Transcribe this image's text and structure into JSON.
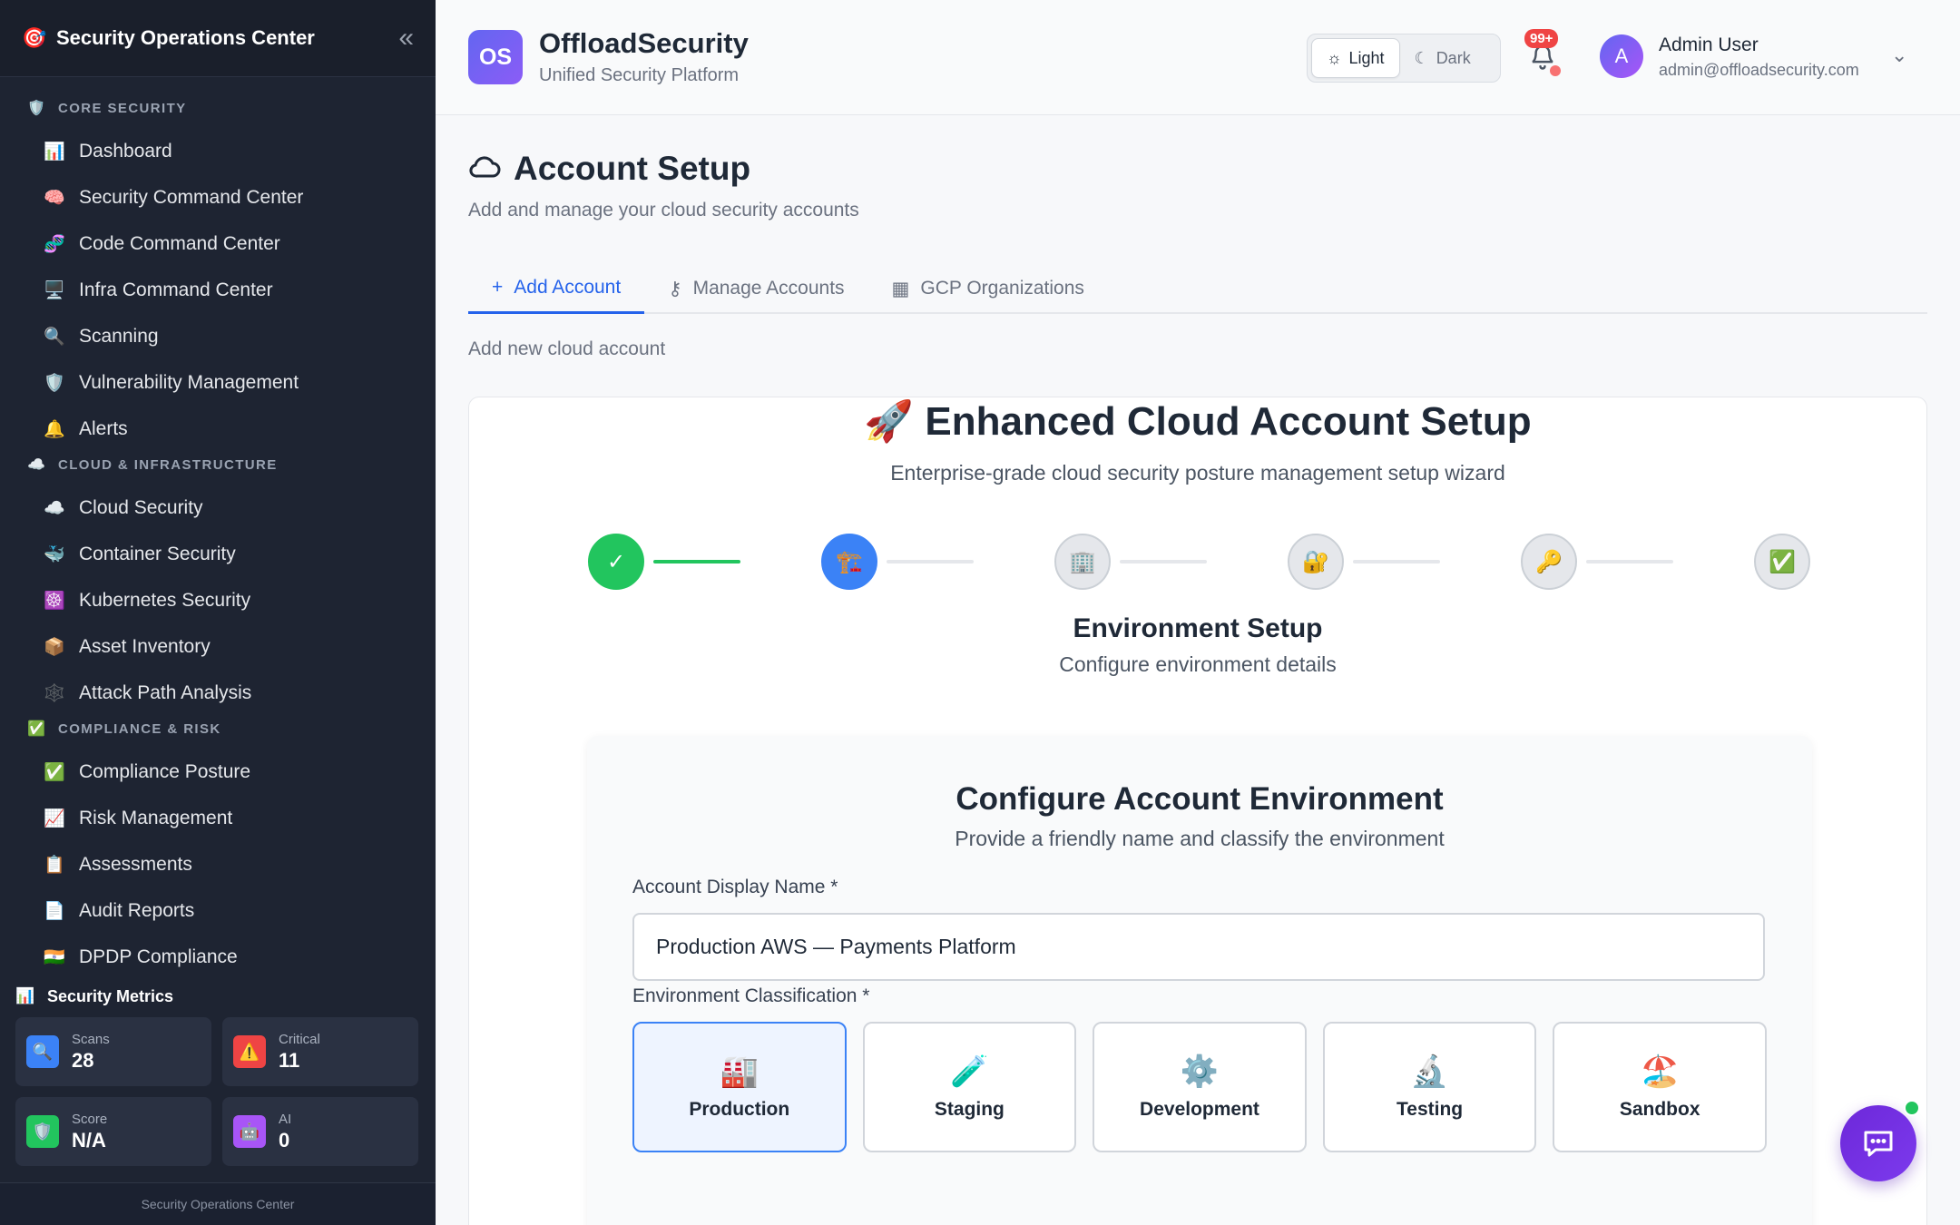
{
  "sidebar": {
    "title": "Security Operations Center",
    "sections": [
      {
        "label": "CORE SECURITY",
        "icon": "🛡️",
        "items": [
          {
            "label": "Dashboard",
            "icon": "📊"
          },
          {
            "label": "Security Command Center",
            "icon": "🧠"
          },
          {
            "label": "Code Command Center",
            "icon": "🧬"
          },
          {
            "label": "Infra Command Center",
            "icon": "🖥️"
          },
          {
            "label": "Scanning",
            "icon": "🔍"
          },
          {
            "label": "Vulnerability Management",
            "icon": "🛡️"
          },
          {
            "label": "Alerts",
            "icon": "🔔"
          }
        ]
      },
      {
        "label": "CLOUD & INFRASTRUCTURE",
        "icon": "☁️",
        "items": [
          {
            "label": "Cloud Security",
            "icon": "☁️"
          },
          {
            "label": "Container Security",
            "icon": "🐳"
          },
          {
            "label": "Kubernetes Security",
            "icon": "☸️"
          },
          {
            "label": "Asset Inventory",
            "icon": "📦"
          },
          {
            "label": "Attack Path Analysis",
            "icon": "🕸️"
          }
        ]
      },
      {
        "label": "COMPLIANCE & RISK",
        "icon": "✅",
        "items": [
          {
            "label": "Compliance Posture",
            "icon": "✅"
          },
          {
            "label": "Risk Management",
            "icon": "📈"
          },
          {
            "label": "Assessments",
            "icon": "📋"
          },
          {
            "label": "Audit Reports",
            "icon": "📄"
          },
          {
            "label": "DPDP Compliance",
            "icon": "🇮🇳"
          }
        ]
      }
    ],
    "metrics_title": "Security Metrics",
    "metrics": [
      {
        "label": "Scans",
        "value": "28",
        "icon": "🔍",
        "color": "#3b82f6"
      },
      {
        "label": "Critical",
        "value": "11",
        "icon": "⚠️",
        "color": "#ef4444"
      },
      {
        "label": "Score",
        "value": "N/A",
        "icon": "🛡️",
        "color": "#22c55e"
      },
      {
        "label": "AI",
        "value": "0",
        "icon": "🤖",
        "color": "#a855f7"
      }
    ],
    "footer": "Security Operations Center"
  },
  "header": {
    "logo_text": "OS",
    "brand": "OffloadSecurity",
    "tagline": "Unified Security Platform",
    "theme_light": "Light",
    "theme_dark": "Dark",
    "notif_badge": "99+",
    "user_initial": "A",
    "user_name": "Admin User",
    "user_email": "admin@offloadsecurity.com"
  },
  "page": {
    "title": "Account Setup",
    "subtitle": "Add and manage your cloud security accounts",
    "tabs": [
      {
        "label": "Add Account",
        "icon": "+"
      },
      {
        "label": "Manage Accounts",
        "icon": "🔑"
      },
      {
        "label": "GCP Organizations",
        "icon": "🏢"
      }
    ],
    "tab_subtitle": "Add new cloud account"
  },
  "wizard": {
    "title": "🚀 Enhanced Cloud Account Setup",
    "subtitle": "Enterprise-grade cloud security posture management setup wizard",
    "steps": [
      {
        "icon": "✓",
        "status": "done"
      },
      {
        "icon": "🏗️",
        "status": "current"
      },
      {
        "icon": "🏢",
        "status": "pending"
      },
      {
        "icon": "🔐",
        "status": "pending"
      },
      {
        "icon": "🔑",
        "status": "pending"
      },
      {
        "icon": "✅",
        "status": "pending"
      }
    ],
    "step_title": "Environment Setup",
    "step_desc": "Configure environment details",
    "form": {
      "title": "Configure Account Environment",
      "subtitle": "Provide a friendly name and classify the environment",
      "name_label": "Account Display Name *",
      "name_value": "Production AWS — Payments Platform",
      "env_label": "Environment Classification *",
      "env_options": [
        {
          "label": "Production",
          "icon": "🏭",
          "selected": true
        },
        {
          "label": "Staging",
          "icon": "🧪",
          "selected": false
        },
        {
          "label": "Development",
          "icon": "⚙️",
          "selected": false
        },
        {
          "label": "Testing",
          "icon": "🔬",
          "selected": false
        },
        {
          "label": "Sandbox",
          "icon": "🏖️",
          "selected": false
        }
      ]
    }
  }
}
